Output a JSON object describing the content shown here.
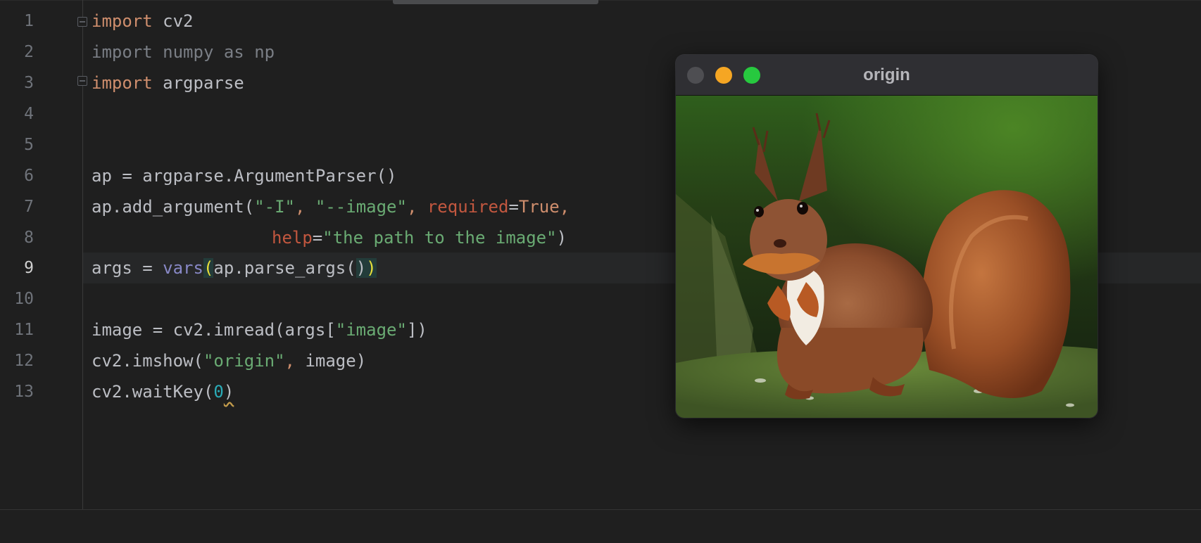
{
  "editor": {
    "lines": [
      {
        "num": "1",
        "tokens": [
          {
            "t": "import",
            "c": "kw"
          },
          {
            "t": " cv2",
            "c": ""
          }
        ]
      },
      {
        "num": "2",
        "tokens": [
          {
            "t": "import numpy as np",
            "c": "dim"
          }
        ]
      },
      {
        "num": "3",
        "tokens": [
          {
            "t": "import",
            "c": "kw"
          },
          {
            "t": " argparse",
            "c": ""
          }
        ]
      },
      {
        "num": "4",
        "tokens": []
      },
      {
        "num": "5",
        "tokens": []
      },
      {
        "num": "6",
        "tokens": [
          {
            "t": "ap = argparse.ArgumentParser()",
            "c": ""
          }
        ]
      },
      {
        "num": "7",
        "tokens": [
          {
            "t": "ap.add_argument(",
            "c": ""
          },
          {
            "t": "\"-I\"",
            "c": "str"
          },
          {
            "t": ", ",
            "c": "kw"
          },
          {
            "t": "\"--image\"",
            "c": "str"
          },
          {
            "t": ", ",
            "c": "kw"
          },
          {
            "t": "required",
            "c": "param"
          },
          {
            "t": "=",
            "c": ""
          },
          {
            "t": "True",
            "c": "kw"
          },
          {
            "t": ",",
            "c": "kw"
          }
        ]
      },
      {
        "num": "8",
        "indent": true,
        "tokens": [
          {
            "t": "help",
            "c": "param"
          },
          {
            "t": "=",
            "c": ""
          },
          {
            "t": "\"the path to the image\"",
            "c": "str"
          },
          {
            "t": ")",
            "c": ""
          }
        ]
      },
      {
        "num": "9",
        "active": true,
        "tokens": [
          {
            "t": "args = ",
            "c": ""
          },
          {
            "t": "vars",
            "c": "builtin"
          },
          {
            "t": "(",
            "c": "brace-match"
          },
          {
            "t": "ap.parse_args(",
            "c": ""
          },
          {
            "t": ")",
            "c": "brace-match2"
          },
          {
            "t": ")",
            "c": "brace-match"
          }
        ]
      },
      {
        "num": "10",
        "tokens": []
      },
      {
        "num": "11",
        "tokens": [
          {
            "t": "image = cv2.imread(args[",
            "c": ""
          },
          {
            "t": "\"image\"",
            "c": "str"
          },
          {
            "t": "])",
            "c": ""
          }
        ]
      },
      {
        "num": "12",
        "tokens": [
          {
            "t": "cv2.imshow(",
            "c": ""
          },
          {
            "t": "\"origin\"",
            "c": "str"
          },
          {
            "t": ", ",
            "c": "kw"
          },
          {
            "t": "image)",
            "c": ""
          }
        ]
      },
      {
        "num": "13",
        "tokens": [
          {
            "t": "cv2.waitKey(",
            "c": ""
          },
          {
            "t": "0",
            "c": "num"
          },
          {
            "t": ")",
            "c": "squiggle"
          }
        ]
      }
    ]
  },
  "window": {
    "title": "origin",
    "image_subject": "red squirrel on mossy ground"
  },
  "colors": {
    "editor_bg": "#1f1f1f",
    "keyword": "#cf8e6d",
    "string": "#6aab73",
    "param": "#c2573f",
    "builtin": "#8888c6",
    "brace_match": "#e8e03a",
    "traffic_min": "#f5a623",
    "traffic_max": "#27c93f"
  }
}
